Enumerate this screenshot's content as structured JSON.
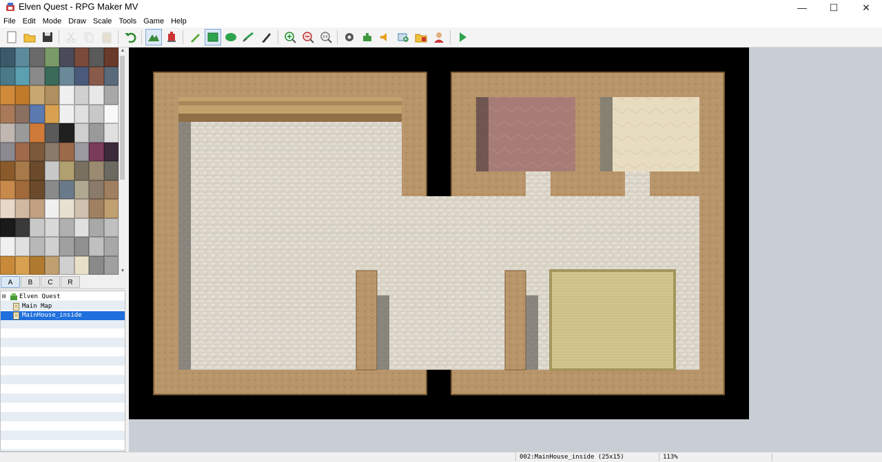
{
  "window": {
    "title": "Elven Quest - RPG Maker MV",
    "controls": {
      "minimize": "—",
      "maximize": "☐",
      "close": "✕"
    }
  },
  "menu": [
    "File",
    "Edit",
    "Mode",
    "Draw",
    "Scale",
    "Tools",
    "Game",
    "Help"
  ],
  "toolbar": [
    {
      "name": "new-project-icon",
      "group": 0
    },
    {
      "name": "open-project-icon",
      "group": 0
    },
    {
      "name": "save-project-icon",
      "group": 0
    },
    {
      "name": "cut-icon",
      "group": 1,
      "disabled": true
    },
    {
      "name": "copy-icon",
      "group": 1,
      "disabled": true
    },
    {
      "name": "paste-icon",
      "group": 1,
      "disabled": true
    },
    {
      "name": "undo-icon",
      "group": 2
    },
    {
      "name": "map-mode-icon",
      "group": 3,
      "active": true
    },
    {
      "name": "event-mode-icon",
      "group": 3
    },
    {
      "name": "pencil-icon",
      "group": 4
    },
    {
      "name": "rectangle-icon",
      "group": 4,
      "active": true
    },
    {
      "name": "ellipse-icon",
      "group": 4
    },
    {
      "name": "fill-icon",
      "group": 4
    },
    {
      "name": "shadow-pen-icon",
      "group": 4
    },
    {
      "name": "zoom-in-icon",
      "group": 5
    },
    {
      "name": "zoom-out-icon",
      "group": 5
    },
    {
      "name": "actual-size-icon",
      "group": 5
    },
    {
      "name": "database-icon",
      "group": 6
    },
    {
      "name": "plugin-manager-icon",
      "group": 6
    },
    {
      "name": "sound-test-icon",
      "group": 6
    },
    {
      "name": "event-searcher-icon",
      "group": 6
    },
    {
      "name": "resource-manager-icon",
      "group": 6
    },
    {
      "name": "character-generator-icon",
      "group": 6
    },
    {
      "name": "playtest-icon",
      "group": 7
    }
  ],
  "tile_tabs": [
    "A",
    "B",
    "C",
    "R"
  ],
  "selected_tile_tab": "A",
  "map_tree": [
    {
      "label": "Elven Quest",
      "level": 0,
      "type": "project",
      "expander": "⊟"
    },
    {
      "label": "Main Map",
      "level": 1,
      "type": "map"
    },
    {
      "label": "MainHouse_inside",
      "level": 1,
      "type": "map",
      "selected": true
    }
  ],
  "status": {
    "map_info": "002:MainHouse_inside (25x15)",
    "zoom": "113%"
  },
  "colors": {
    "wall_outer": "#9a7a4e",
    "wall_top": "#c4a26e",
    "floor": "#d8d2c6",
    "black": "#000000",
    "selection": "#1f6fdc"
  }
}
